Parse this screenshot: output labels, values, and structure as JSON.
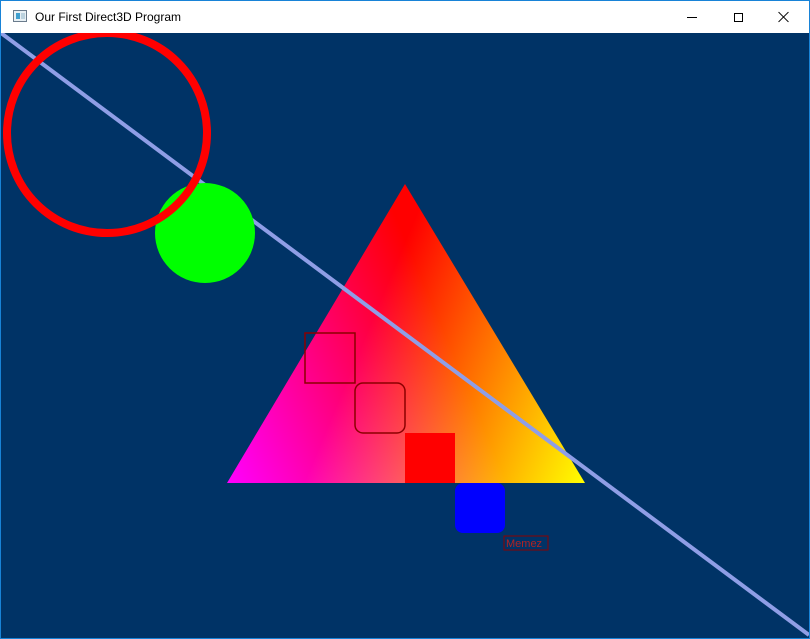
{
  "window": {
    "title": "Our First Direct3D Program",
    "icon": "application-icon",
    "buttons": {
      "minimize": "minimize-icon",
      "maximize": "maximize-icon",
      "close": "close-icon"
    }
  },
  "scene": {
    "background_color": "#003366",
    "text_label": "Memez",
    "colors": {
      "circle_outline": "#ff0000",
      "circle_filled": "#00ff00",
      "line": "#8f9ee6",
      "triangle_top": "#ff0000",
      "triangle_left": "#0000ff",
      "triangle_right": "#00ff00",
      "square_outline": "#8b0000",
      "rounded_square_outline": "#8b0000",
      "square_filled": "#ff0000",
      "rounded_square_filled": "#0000ff",
      "label_text": "#b22222",
      "label_box": "#8b0000"
    }
  }
}
